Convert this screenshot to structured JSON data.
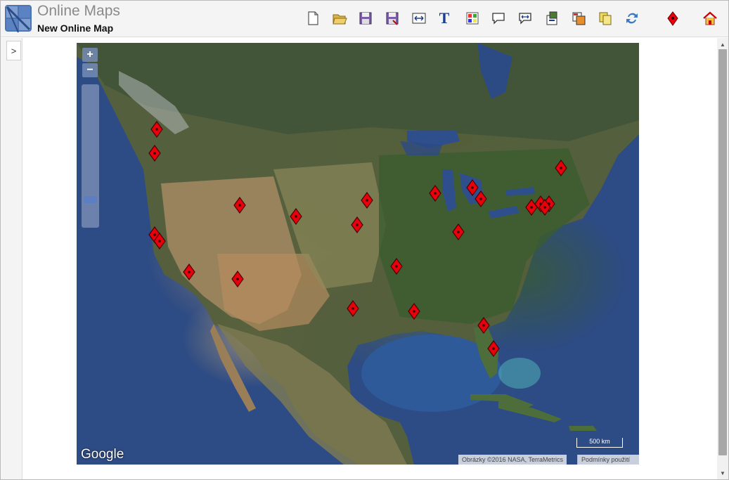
{
  "header": {
    "app_title": "Online Maps",
    "doc_title": "New Online Map"
  },
  "toolbar": {
    "tools": [
      {
        "name": "new-document-icon"
      },
      {
        "name": "open-folder-icon"
      },
      {
        "name": "save-icon"
      },
      {
        "name": "save-as-icon"
      },
      {
        "name": "resize-width-icon"
      },
      {
        "name": "text-icon",
        "glyph": "T"
      },
      {
        "name": "color-palette-icon"
      },
      {
        "name": "speech-bubble-icon"
      },
      {
        "name": "speech-resize-icon"
      },
      {
        "name": "export-icon"
      },
      {
        "name": "import-icon"
      },
      {
        "name": "copy-icon"
      },
      {
        "name": "refresh-icon"
      },
      {
        "name": "marker-icon"
      },
      {
        "name": "home-icon"
      }
    ]
  },
  "sidebar": {
    "toggle_label": ">"
  },
  "map": {
    "zoom_in_label": "+",
    "zoom_out_label": "−",
    "google_label": "Google",
    "scale_label": "500 km",
    "attribution": "Obrázky ©2016 NASA, TerraMetrics",
    "terms_label": "Podmínky použití",
    "marker_color": "#e8000b",
    "marker_count": 30
  },
  "colors": {
    "ocean": "#2d4b84",
    "land_green": "#3e5a32",
    "desert": "#b09670"
  }
}
